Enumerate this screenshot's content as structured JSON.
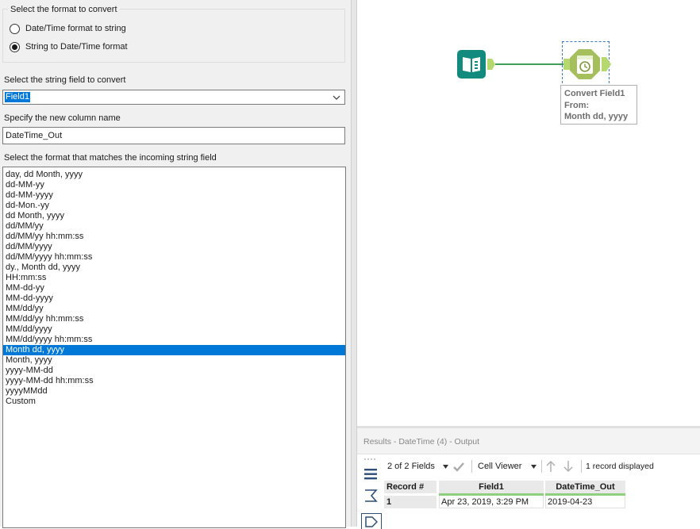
{
  "config": {
    "format_group": {
      "title": "Select the format to convert",
      "options": [
        {
          "label": "Date/Time format to string",
          "checked": false
        },
        {
          "label": "String to Date/Time format",
          "checked": true
        }
      ]
    },
    "string_field": {
      "label": "Select the string field to convert",
      "value": "Field1"
    },
    "column_name": {
      "label": "Specify the new column name",
      "value": "DateTime_Out"
    },
    "format_list": {
      "label": "Select the format that matches the incoming string field",
      "selected_index": 17,
      "items": [
        "day, dd Month, yyyy",
        "dd-MM-yy",
        "dd-MM-yyyy",
        "dd-Mon.-yy",
        "dd Month, yyyy",
        "dd/MM/yy",
        "dd/MM/yy hh:mm:ss",
        "dd/MM/yyyy",
        "dd/MM/yyyy hh:mm:ss",
        "dy., Month dd, yyyy",
        "HH:mm:ss",
        "MM-dd-yy",
        "MM-dd-yyyy",
        "MM/dd/yy",
        "MM/dd/yy hh:mm:ss",
        "MM/dd/yyyy",
        "MM/dd/yyyy hh:mm:ss",
        "Month dd, yyyy",
        "Month, yyyy",
        "yyyy-MM-dd",
        "yyyy-MM-dd hh:mm:ss",
        "yyyyMMdd",
        "Custom"
      ]
    }
  },
  "canvas": {
    "annotation": [
      "Convert Field1",
      "From:",
      "Month dd, yyyy"
    ],
    "icons": {
      "input": "book-input-icon",
      "tool": "datetime-clock-icon"
    },
    "colors": {
      "input_tool": "#138a7e",
      "datetime_tool": "#a5bf5c",
      "connector": "#3f9d58"
    }
  },
  "results": {
    "title": "Results - DateTime (4) - Output",
    "toolbar": {
      "fields": "2 of 2 Fields",
      "viewer": "Cell Viewer",
      "record_count": "1 record displayed"
    },
    "table": {
      "headers": [
        "Record #",
        "Field1",
        "DateTime_Out"
      ],
      "rows": [
        [
          "1",
          "Apr 23, 2019, 3:29 PM",
          "2019-04-23"
        ]
      ]
    }
  },
  "accent_color": "#0078d7"
}
